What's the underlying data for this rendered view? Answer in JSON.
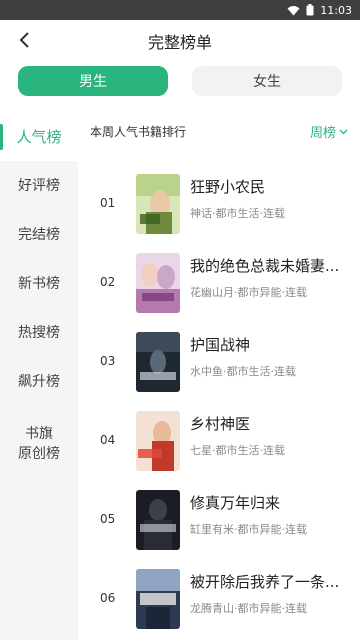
{
  "status_bar": {
    "time": "11:03"
  },
  "header": {
    "title": "完整榜单"
  },
  "gender_tabs": [
    {
      "label": "男生",
      "active": true
    },
    {
      "label": "女生",
      "active": false
    }
  ],
  "sidebar": {
    "items": [
      {
        "label": "人气榜",
        "active": true
      },
      {
        "label": "好评榜"
      },
      {
        "label": "完结榜"
      },
      {
        "label": "新书榜"
      },
      {
        "label": "热搜榜"
      },
      {
        "label": "飙升榜"
      },
      {
        "label": "书旗\n原创榜"
      }
    ]
  },
  "ranking": {
    "label": "本周人气书籍排行",
    "period": "周榜"
  },
  "books": [
    {
      "rank": "01",
      "title": "狂野小农民",
      "meta": "神话·都市生活·连载"
    },
    {
      "rank": "02",
      "title": "我的绝色总裁未婚妻...",
      "meta": "花幽山月·都市异能·连载"
    },
    {
      "rank": "03",
      "title": "护国战神",
      "meta": "水中鱼·都市生活·连载"
    },
    {
      "rank": "04",
      "title": "乡村神医",
      "meta": "七星·都市生活·连载"
    },
    {
      "rank": "05",
      "title": "修真万年归来",
      "meta": "缸里有米·都市异能·连载"
    },
    {
      "rank": "06",
      "title": "被开除后我养了一条...",
      "meta": "龙腾青山·都市异能·连载"
    }
  ],
  "colors": {
    "accent": "#2bb57e",
    "sidebar_bg": "#f5f5f5"
  },
  "icons": {
    "back": "chevron-left-icon",
    "period_dropdown": "chevron-down-icon"
  }
}
